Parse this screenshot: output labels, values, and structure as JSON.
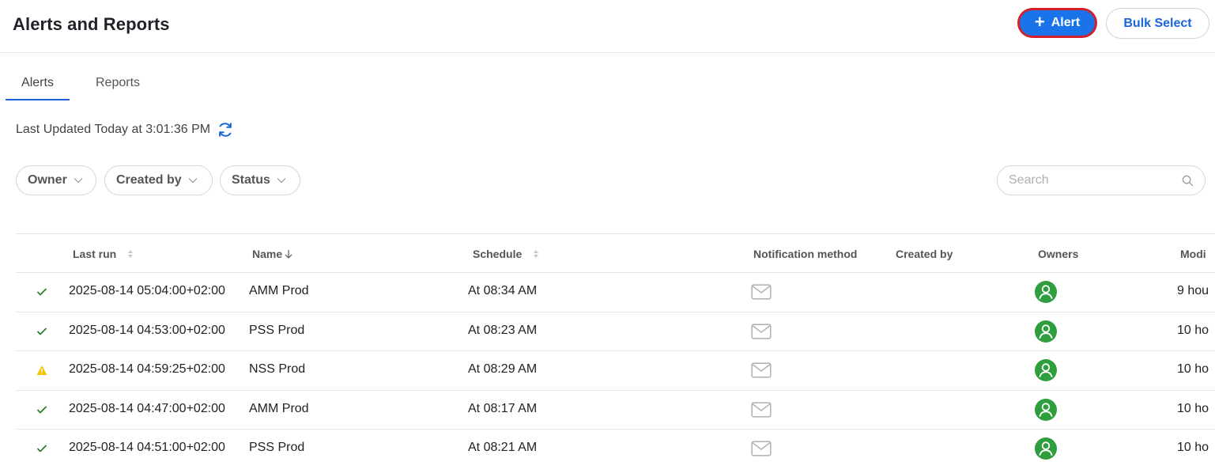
{
  "header": {
    "title": "Alerts and Reports",
    "alert_button": "Alert",
    "bulk_select_button": "Bulk Select"
  },
  "tabs": [
    {
      "label": "Alerts",
      "active": true
    },
    {
      "label": "Reports",
      "active": false
    }
  ],
  "last_updated": "Last Updated Today at 3:01:36 PM",
  "filters": {
    "owner": "Owner",
    "created_by": "Created by",
    "status": "Status"
  },
  "search": {
    "placeholder": "Search",
    "value": ""
  },
  "table": {
    "columns": {
      "last_run": "Last run",
      "name": "Name",
      "schedule": "Schedule",
      "notification_method": "Notification method",
      "created_by": "Created by",
      "owners": "Owners",
      "modified": "Modi"
    },
    "rows": [
      {
        "status": "success",
        "last_run": "2025-08-14 05:04:00+02:00",
        "name": "AMM Prod",
        "schedule": "At 08:34 AM",
        "notification": "mail-icon",
        "created_by": "",
        "owner": "user-avatar-icon",
        "modified": "9 hou"
      },
      {
        "status": "success",
        "last_run": "2025-08-14 04:53:00+02:00",
        "name": "PSS Prod",
        "schedule": "At 08:23 AM",
        "notification": "mail-icon",
        "created_by": "",
        "owner": "user-avatar-icon",
        "modified": "10 ho"
      },
      {
        "status": "warning",
        "last_run": "2025-08-14 04:59:25+02:00",
        "name": "NSS Prod",
        "schedule": "At 08:29 AM",
        "notification": "mail-icon",
        "created_by": "",
        "owner": "user-avatar-icon",
        "modified": "10 ho"
      },
      {
        "status": "success",
        "last_run": "2025-08-14 04:47:00+02:00",
        "name": "AMM Prod",
        "schedule": "At 08:17 AM",
        "notification": "mail-icon",
        "created_by": "",
        "owner": "user-avatar-icon",
        "modified": "10 ho"
      },
      {
        "status": "success",
        "last_run": "2025-08-14 04:51:00+02:00",
        "name": "PSS Prod",
        "schedule": "At 08:21 AM",
        "notification": "mail-icon",
        "created_by": "",
        "owner": "user-avatar-icon",
        "modified": "10 ho"
      }
    ]
  },
  "colors": {
    "primary": "#1a73e8",
    "highlight_border": "#d3202a",
    "success": "#2e7d32",
    "warning": "#f5c400",
    "avatar": "#2e9e3e",
    "mail_icon": "#b5b5b5"
  }
}
